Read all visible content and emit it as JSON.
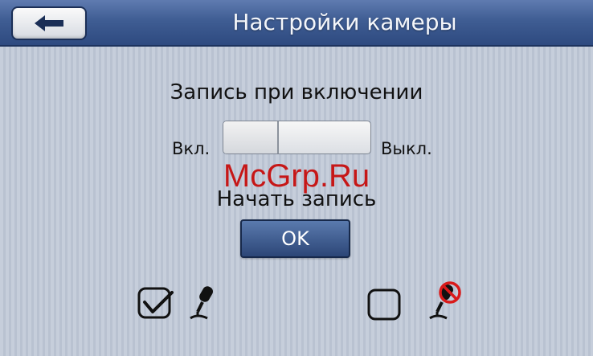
{
  "header": {
    "title": "Настройки камеры",
    "back_icon": "arrow-left-icon"
  },
  "record_on_start": {
    "label": "Запись при включении",
    "on_label": "Вкл.",
    "off_label": "Выкл.",
    "state": "on"
  },
  "watermark": "McGrp.Ru",
  "start_recording": {
    "label": "Начать запись",
    "ok_label": "OK"
  },
  "options": [
    {
      "checked": true,
      "icon": "microphone-icon"
    },
    {
      "checked": false,
      "icon": "microphone-muted-icon"
    }
  ],
  "colors": {
    "header": "#3f5d93",
    "background": "#c3cbd8",
    "accent": "#2c4677",
    "watermark": "#c61717",
    "mute_badge": "#d91a1a"
  }
}
